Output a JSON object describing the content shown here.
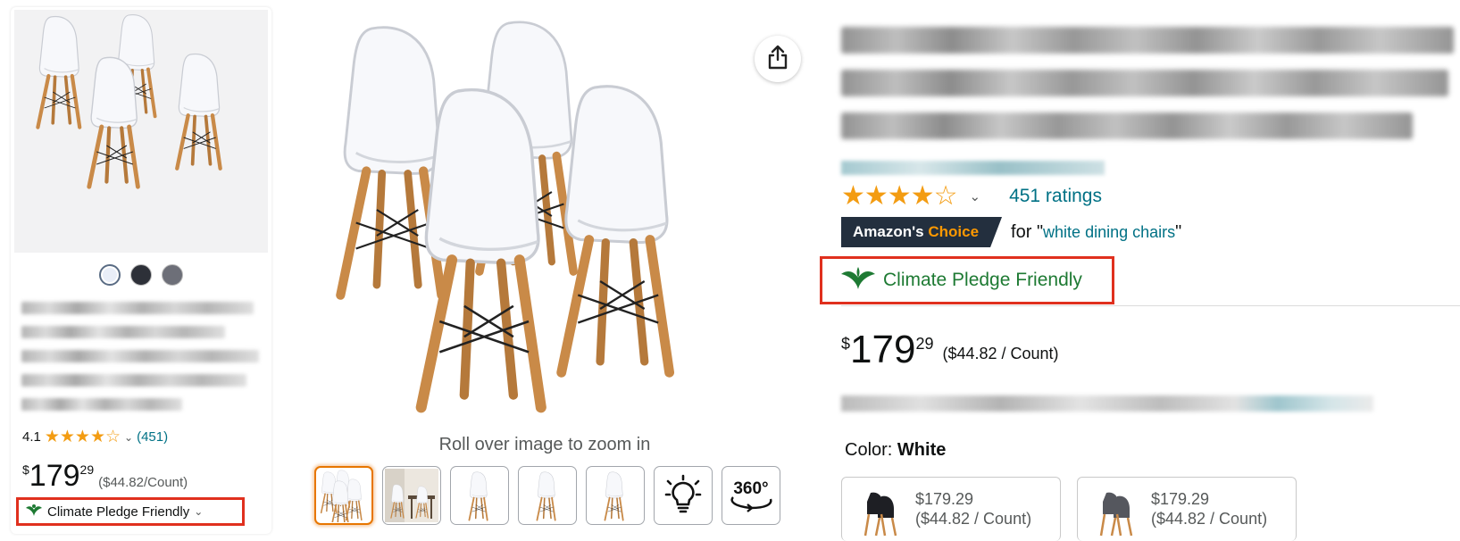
{
  "card": {
    "rating_value": "4.1",
    "rating_stars": "★★★★☆",
    "rating_count": "(451)",
    "price_symbol": "$",
    "price_whole": "179",
    "price_fraction": "29",
    "price_per_unit": "($44.82/Count)",
    "climate_label": "Climate Pledge Friendly",
    "swatches": [
      "#e9eef8",
      "#2d3038",
      "#6d6f78"
    ]
  },
  "gallery": {
    "zoom_hint": "Roll over image to zoom in",
    "thumbnails": [
      "chairs-set",
      "dining-scene",
      "single-chair",
      "single-chair-front",
      "single-chair-side",
      "lightbulb-icon",
      "360-view-icon"
    ]
  },
  "product": {
    "ratings_text": "451 ratings",
    "stars": "★★★★☆",
    "choice_brand": "Amazon's",
    "choice_word": "Choice",
    "choice_for": "for",
    "choice_query": "white dining chairs",
    "climate_label": "Climate Pledge Friendly",
    "price_symbol": "$",
    "price_whole": "179",
    "price_fraction": "29",
    "price_per_unit": "($44.82 / Count)",
    "color_label": "Color:",
    "color_value": "White"
  },
  "options": [
    {
      "price": "$179.29",
      "per_unit": "($44.82 / Count)",
      "color": "#1e1f24"
    },
    {
      "price": "$179.29",
      "per_unit": "($44.82 / Count)",
      "color": "#55575e"
    }
  ],
  "colors": {
    "link": "#007185",
    "star": "#f39c12",
    "badge_bg": "#232f3e",
    "badge_accent": "#ff9900",
    "climate_green": "#1e7a33",
    "highlight_red": "#e0301e"
  }
}
